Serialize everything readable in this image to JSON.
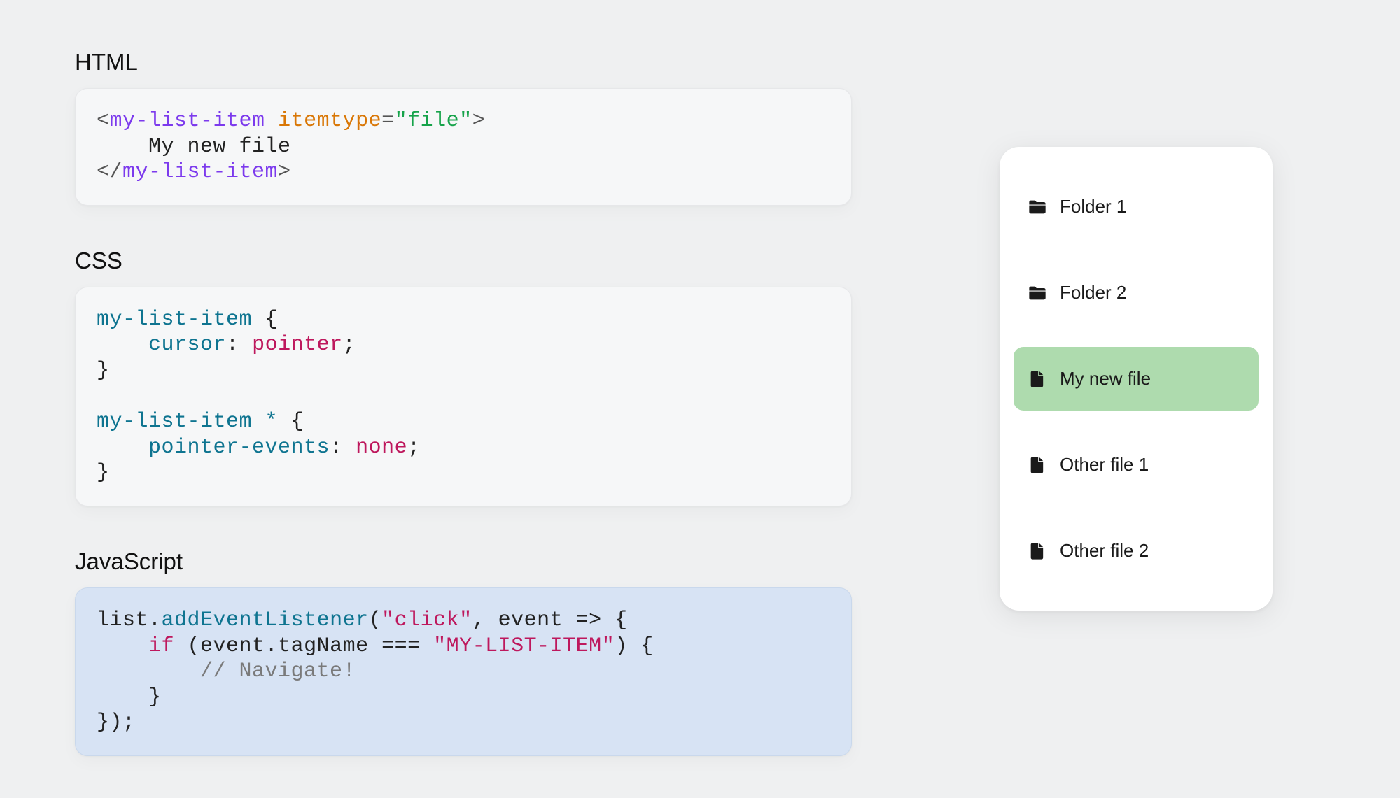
{
  "sections": {
    "html": {
      "heading": "HTML",
      "code": {
        "tag": "my-list-item",
        "attr": "itemtype",
        "attr_value": "file",
        "inner_text": "My new file"
      }
    },
    "css": {
      "heading": "CSS",
      "code": {
        "selector1": "my-list-item",
        "rule1_prop": "cursor",
        "rule1_val": "pointer",
        "selector2": "my-list-item *",
        "rule2_prop": "pointer-events",
        "rule2_val": "none"
      }
    },
    "js": {
      "heading": "JavaScript",
      "code": {
        "obj": "list",
        "method": "addEventListener",
        "event": "click",
        "param": "event",
        "prop": "tagName",
        "cmp": "MY-LIST-ITEM",
        "comment": "// Navigate!"
      }
    }
  },
  "file_list": {
    "items": [
      {
        "type": "folder",
        "label": "Folder 1",
        "selected": false
      },
      {
        "type": "folder",
        "label": "Folder 2",
        "selected": false
      },
      {
        "type": "file",
        "label": "My new file",
        "selected": true
      },
      {
        "type": "file",
        "label": "Other file 1",
        "selected": false
      },
      {
        "type": "file",
        "label": "Other file 2",
        "selected": false
      }
    ]
  },
  "colors": {
    "page_bg": "#eff0f1",
    "code_bg": "#f6f7f8",
    "code_js_bg": "#d7e3f4",
    "panel_bg": "#ffffff",
    "selected_bg": "#aedbae"
  }
}
